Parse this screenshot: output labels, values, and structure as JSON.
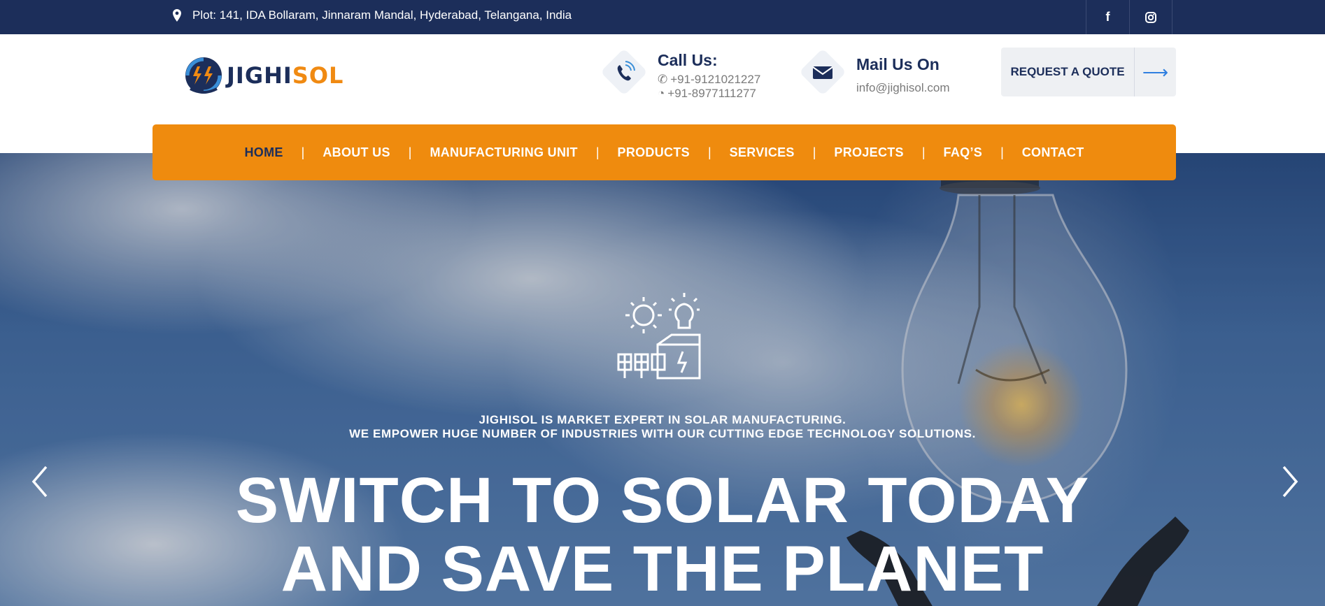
{
  "topbar": {
    "address": "Plot: 141, IDA Bollaram, Jinnaram Mandal, Hyderabad, Telangana, India",
    "social": [
      {
        "icon": "facebook-icon",
        "glyph": "f"
      },
      {
        "icon": "instagram-icon",
        "glyph": "◎"
      }
    ]
  },
  "logo": {
    "part1": "JIGHI",
    "part2": "SOL"
  },
  "call": {
    "title": "Call Us:",
    "phone": "+91-9121021227",
    "whatsapp": "+91-8977111277"
  },
  "mail": {
    "title": "Mail Us On",
    "email": "info@jighisol.com"
  },
  "quote": {
    "label": "REQUEST A QUOTE",
    "arrow": "⟶"
  },
  "nav": {
    "separator": "|",
    "items": [
      "HOME",
      "ABOUT US",
      "MANUFACTURING UNIT",
      "PRODUCTS",
      "SERVICES",
      "PROJECTS",
      "FAQ’S",
      "CONTACT"
    ],
    "active": "HOME"
  },
  "hero": {
    "sub1": "JIGHISOL IS MARKET EXPERT IN SOLAR MANUFACTURING.",
    "sub2": "WE EMPOWER HUGE NUMBER OF INDUSTRIES WITH OUR CUTTING EDGE TECHNOLOGY SOLUTIONS.",
    "title1": "SWITCH TO SOLAR TODAY",
    "title2": "AND SAVE THE PLANET"
  },
  "colors": {
    "navy": "#1c2e5a",
    "orange": "#ef8b0e",
    "accent_blue": "#2f7fe0"
  }
}
